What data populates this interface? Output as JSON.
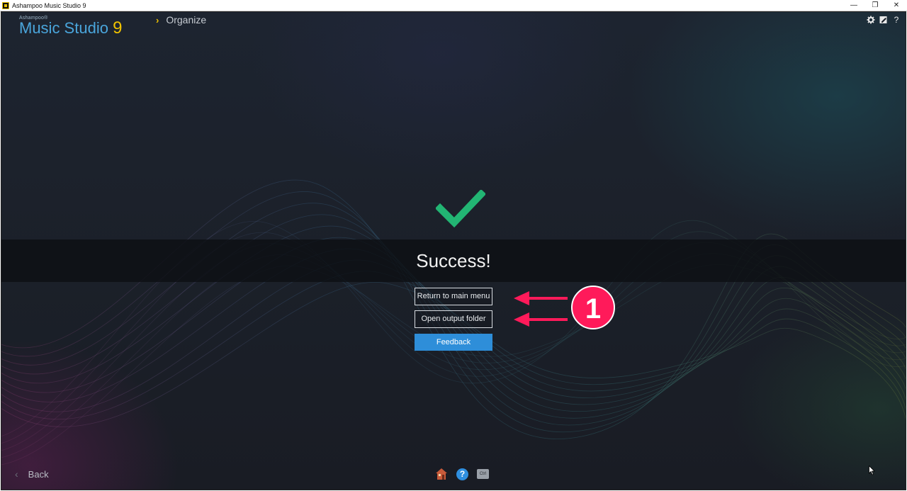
{
  "window": {
    "title": "Ashampoo Music Studio 9",
    "controls": {
      "minimize": "—",
      "restore": "❐",
      "close": "✕"
    }
  },
  "brand": {
    "small": "Ashampoo®",
    "main": "Music Studio",
    "number": "9"
  },
  "breadcrumb": {
    "label": "Organize"
  },
  "header_icons": [
    "gear-icon",
    "edit-icon",
    "help-icon"
  ],
  "header_help": "?",
  "status": {
    "title": "Success!",
    "accent": "#22b573"
  },
  "actions": {
    "return_label": "Return to main menu",
    "open_label": "Open output folder",
    "feedback_label": "Feedback",
    "feedback_color": "#2e8ed9"
  },
  "annotation": {
    "number": "1",
    "color": "#ff1a5a"
  },
  "footer": {
    "back_label": "Back",
    "help_symbol": "?",
    "keyboard_label": "Ctrl"
  }
}
